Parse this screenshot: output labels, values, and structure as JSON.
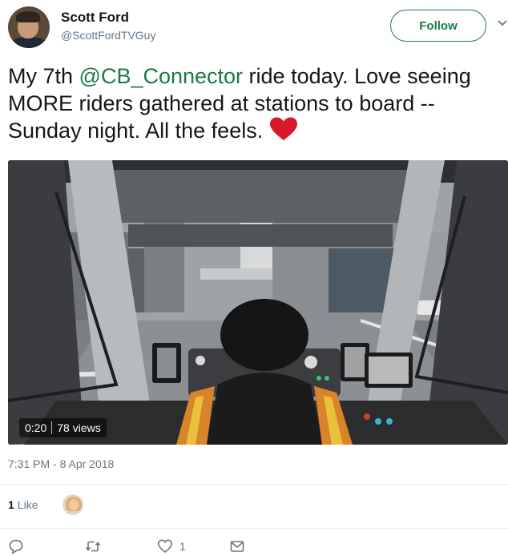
{
  "author": {
    "name": "Scott Ford",
    "handle": "@ScottFordTVGuy"
  },
  "follow_label": "Follow",
  "tweet": {
    "text_before": "My 7th ",
    "mention": "@CB_Connector",
    "text_after": " ride today. Love seeing MORE riders gathered at stations to board --Sunday night. All the feels. "
  },
  "video": {
    "duration": "0:20",
    "views": "78 views"
  },
  "timestamp": "7:31 PM - 8 Apr 2018",
  "likes": {
    "count": "1",
    "label": "Like"
  },
  "actions": {
    "reply_icon": "reply-icon",
    "retweet_icon": "retweet-icon",
    "like_icon": "heart-icon",
    "like_count": "1",
    "message_icon": "envelope-icon"
  },
  "colors": {
    "accent": "#1b7a49",
    "text": "#14171a",
    "muted": "#657786",
    "heart_emoji": "#d7182a"
  }
}
